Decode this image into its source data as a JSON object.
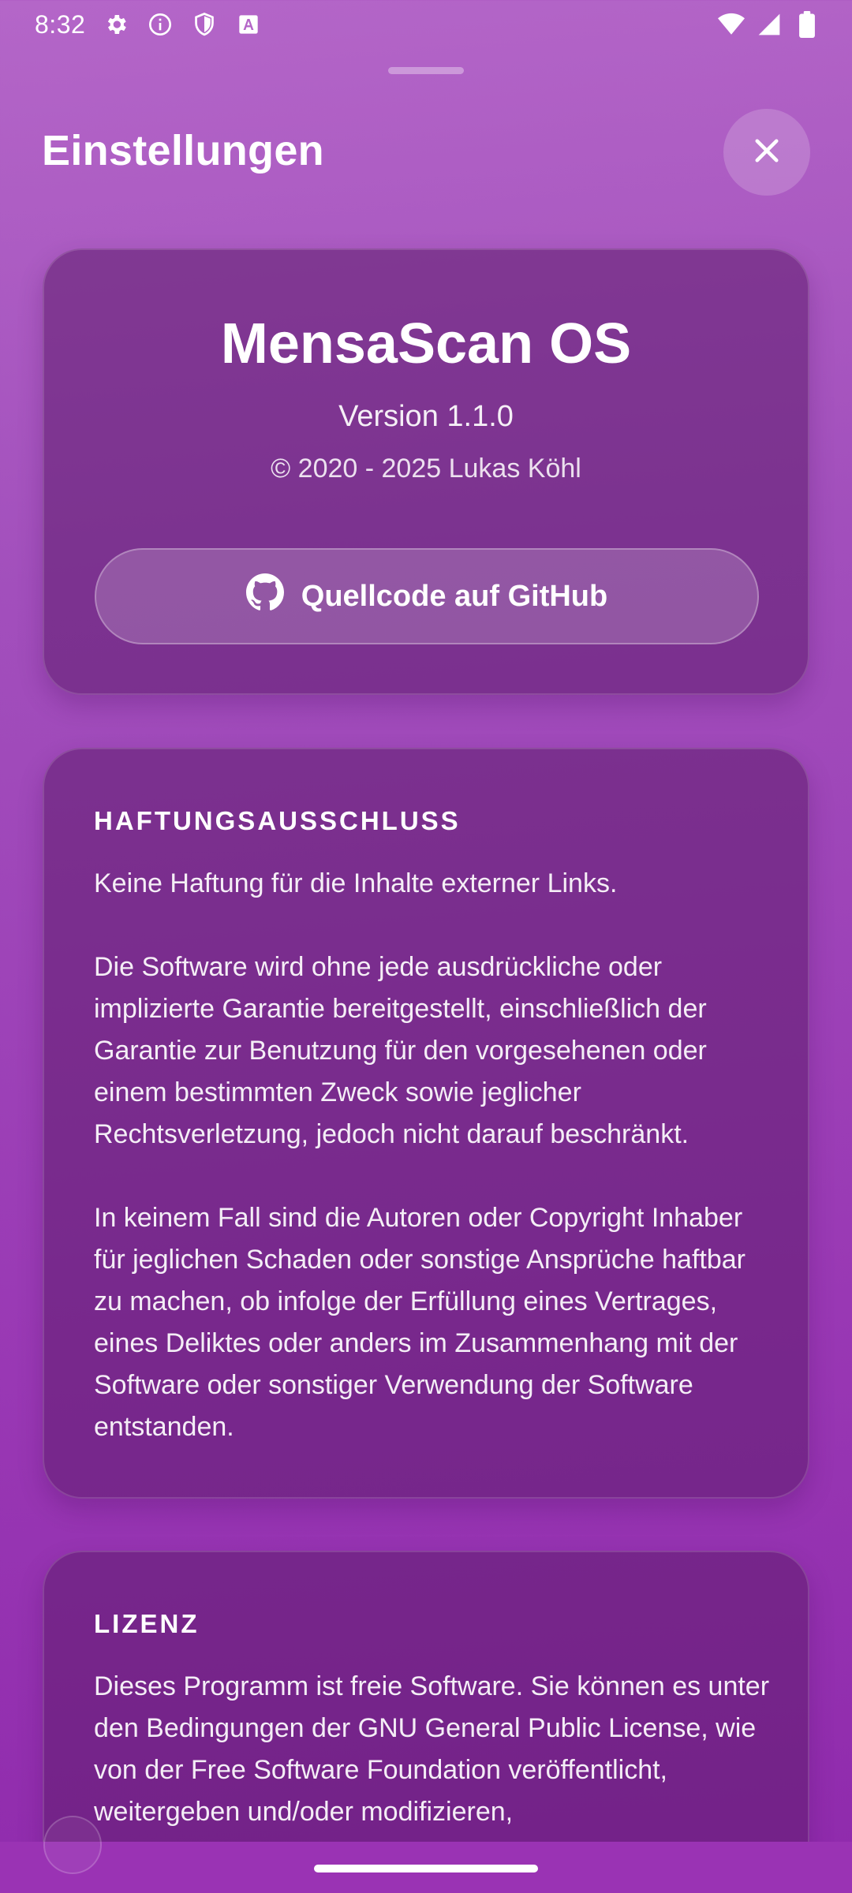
{
  "status_bar": {
    "time": "8:32",
    "left_icons": [
      "gear-icon",
      "info-circle-icon",
      "shield-icon",
      "font-a-icon"
    ],
    "right_icons": [
      "wifi-icon",
      "signal-icon",
      "battery-icon"
    ]
  },
  "header": {
    "title": "Einstellungen",
    "close_icon": "close-icon"
  },
  "app_card": {
    "name": "MensaScan OS",
    "version": "Version 1.1.0",
    "copyright": "© 2020 - 2025 Lukas Köhl",
    "github_button": "Quellcode auf GitHub",
    "github_icon": "github-icon"
  },
  "disclaimer": {
    "title": "HAFTUNGSAUSSCHLUSS",
    "paragraphs": [
      "Keine Haftung für die Inhalte externer Links.",
      "Die Software wird ohne jede ausdrückliche oder implizierte Garantie bereitgestellt, einschließlich der Garantie zur Benutzung für den vorgesehenen oder einem bestimmten Zweck sowie jeglicher Rechtsverletzung, jedoch nicht darauf beschränkt.",
      "In keinem Fall sind die Autoren oder Copyright Inhaber für jeglichen Schaden oder sonstige Ansprüche haftbar zu machen, ob infolge der Erfüllung eines Vertrages, eines Deliktes oder anders im Zusammenhang mit der Software oder sonstiger Verwendung der Software entstanden."
    ]
  },
  "license": {
    "title": "LIZENZ",
    "body": "Dieses Programm ist freie Software. Sie können es unter den Bedingungen der GNU General Public License, wie von der Free Software Foundation veröffentlicht, weitergeben und/oder modifizieren,"
  }
}
